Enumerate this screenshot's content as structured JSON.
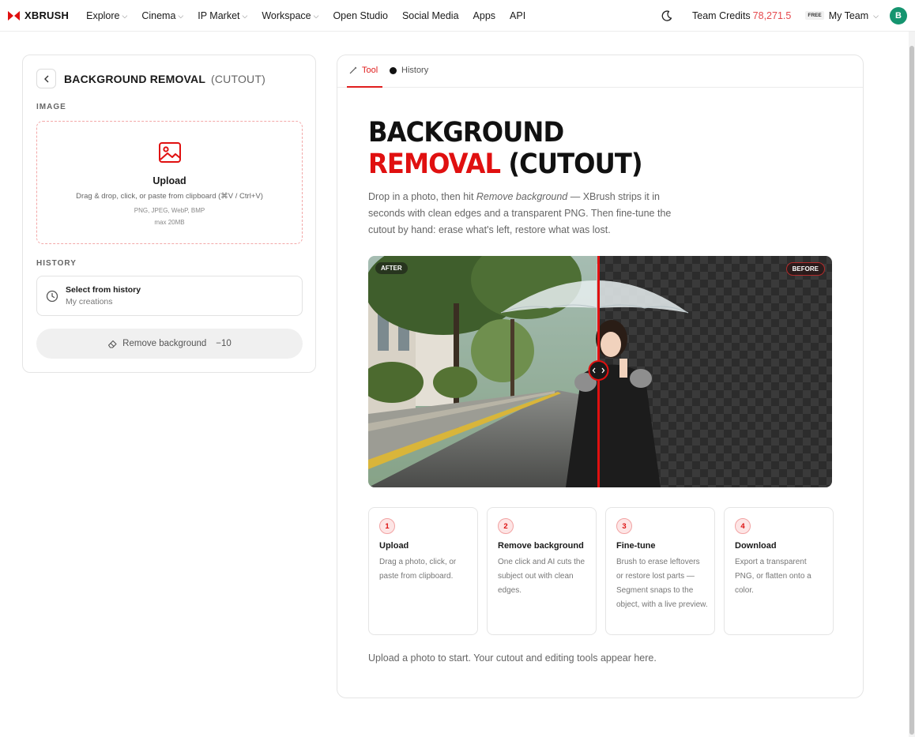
{
  "nav": {
    "logo": "XBRUSH",
    "items": [
      {
        "label": "Explore",
        "dropdown": true
      },
      {
        "label": "Cinema",
        "dropdown": true
      },
      {
        "label": "IP Market",
        "dropdown": true
      },
      {
        "label": "Workspace",
        "dropdown": true
      },
      {
        "label": "Open Studio",
        "dropdown": false
      },
      {
        "label": "Social Media",
        "dropdown": false
      },
      {
        "label": "Apps",
        "dropdown": false
      },
      {
        "label": "API",
        "dropdown": false
      }
    ],
    "credits_label": "Team Credits",
    "credits_value": "78,271.5",
    "plan_badge": "FREE",
    "team_label": "My Team",
    "avatar_letter": "B",
    "theme_icon": "moon-icon"
  },
  "left_panel": {
    "title": "BACKGROUND REMOVAL",
    "title_suffix": "(CUTOUT)",
    "image_label": "IMAGE",
    "upload_title": "Upload",
    "upload_hint": "Drag & drop, click, or paste from clipboard (⌘V / Ctrl+V)",
    "upload_formats": "PNG, JPEG, WebP, BMP",
    "upload_max": "max 20MB",
    "history_label": "HISTORY",
    "history_title": "Select from history",
    "history_sub": "My creations",
    "remove_label": "Remove background",
    "remove_cost": "−10"
  },
  "right_panel": {
    "tabs": [
      {
        "label": "Tool",
        "active": true
      },
      {
        "label": "History",
        "active": false
      }
    ],
    "hero_line1": "BACKGROUND",
    "hero_line2_red": "REMOVAL",
    "hero_line2_rest": " (CUTOUT)",
    "desc_pre": "Drop in a photo, then hit ",
    "desc_em": "Remove background",
    "desc_post": " — XBrush strips it in seconds with clean edges and a transparent PNG. Then fine-tune the cutout by hand: erase what's left, restore what was lost.",
    "after_tag": "AFTER",
    "before_tag": "BEFORE",
    "steps": [
      {
        "num": "1",
        "title": "Upload",
        "text": "Drag a photo, click, or paste from clipboard."
      },
      {
        "num": "2",
        "title": "Remove background",
        "text": "One click and AI cuts the subject out with clean edges."
      },
      {
        "num": "3",
        "title": "Fine-tune",
        "text": "Brush to erase leftovers or restore lost parts — Segment snaps to the object, with a live preview."
      },
      {
        "num": "4",
        "title": "Download",
        "text": "Export a transparent PNG, or flatten onto a color."
      }
    ],
    "footer_note": "Upload a photo to start. Your cutout and editing tools appear here."
  },
  "colors": {
    "accent_red": "#e01010",
    "credits_red": "#e5484d",
    "avatar_green": "#15946f"
  }
}
